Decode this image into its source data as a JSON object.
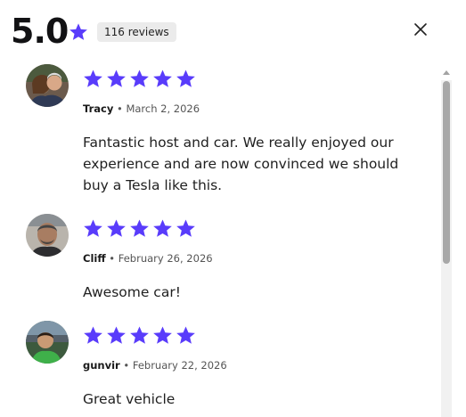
{
  "summary": {
    "rating": "5.0",
    "reviews_count": "116 reviews",
    "accent_color": "#593cfb"
  },
  "icons": {
    "close": "close-icon",
    "star": "star-icon"
  },
  "reviews": [
    {
      "name": "Tracy",
      "date": "March 2, 2026",
      "rating": 5,
      "text": "Fantastic host and car. We really enjoyed our experience and are now convinced we should buy a Tesla like this."
    },
    {
      "name": "Cliff",
      "date": "February 26, 2026",
      "rating": 5,
      "text": "Awesome car!"
    },
    {
      "name": "gunvir",
      "date": "February 22, 2026",
      "rating": 5,
      "text": "Great vehicle"
    }
  ]
}
